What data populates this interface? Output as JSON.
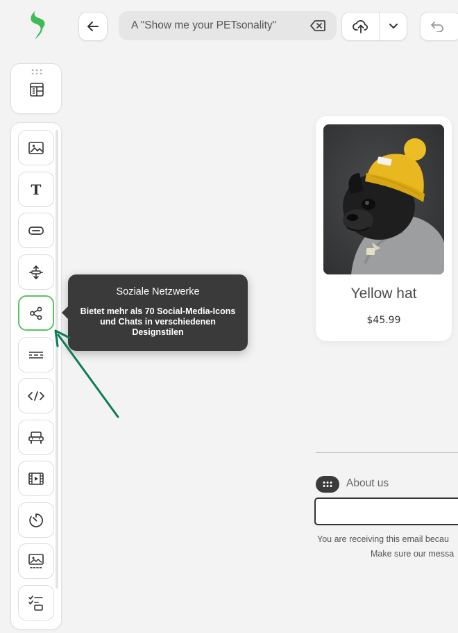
{
  "header": {
    "search_value": "A \"Show me your PETsonality\""
  },
  "tooltip": {
    "title": "Soziale Netzwerke",
    "description": "Bietet mehr als 70 Social-Media-Icons und Chats in verschiedenen Designstilen"
  },
  "product": {
    "title": "Yellow hat",
    "price": "$45.99"
  },
  "footer": {
    "about_label": "About us",
    "notice_line1": "You are receiving this email becau",
    "notice_line2": "Make sure our messa"
  },
  "colors": {
    "brand": "#3dbb55",
    "active_border": "#5ac262",
    "arrow": "#0c7c55",
    "tooltip_bg": "#3a3a3a"
  },
  "tools": [
    "image-icon",
    "text-icon",
    "button-icon",
    "spacer-icon",
    "share-icon",
    "divider-icon",
    "html-code-icon",
    "menu-icon",
    "video-icon",
    "timer-icon",
    "banner-icon",
    "amp-form-icon"
  ]
}
